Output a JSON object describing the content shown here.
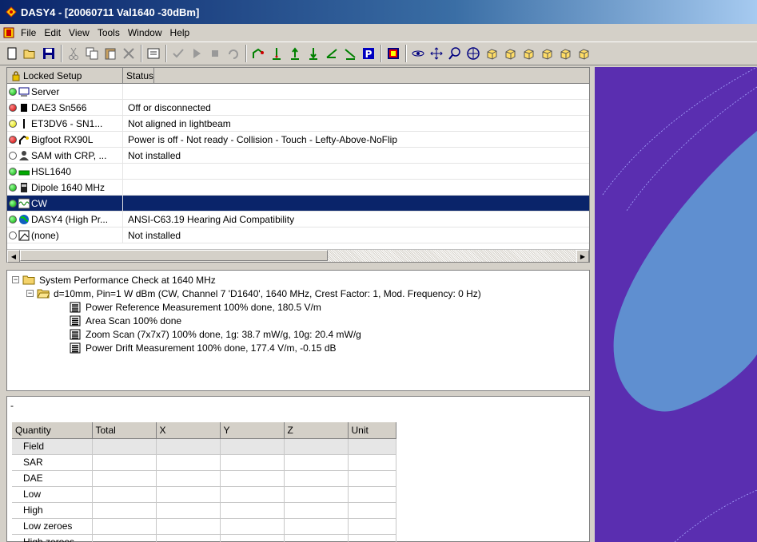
{
  "window": {
    "title": "DASY4 - [20060711 Val1640 -30dBm]"
  },
  "menu": [
    "File",
    "Edit",
    "View",
    "Tools",
    "Window",
    "Help"
  ],
  "toolbar": {
    "icons": [
      "new-icon",
      "open-icon",
      "save-icon",
      "|",
      "cut-icon",
      "copy-icon",
      "paste-icon",
      "delete-icon",
      "|",
      "properties-icon",
      "|",
      "check-icon",
      "play-icon",
      "stop-icon",
      "undo-icon",
      "|",
      "robot-teach-icon",
      "probe-icon",
      "probe-up-icon",
      "probe-down-icon",
      "probe-left-icon",
      "probe-right-icon",
      "parking-icon",
      "|",
      "spectrum-icon",
      "|",
      "rotate-icon",
      "move-icon",
      "zoom-icon",
      "center-icon",
      "cube-1-icon",
      "cube-2-icon",
      "cube-3-icon",
      "cube-4-icon",
      "cube-5-icon",
      "cube-6-icon"
    ]
  },
  "setup": {
    "header": {
      "col1": "Locked Setup",
      "col2": "Status"
    },
    "rows": [
      {
        "dot": "green",
        "icon": "server-icon",
        "name": "Server",
        "status": ""
      },
      {
        "dot": "red",
        "icon": "dae-icon",
        "name": "DAE3 Sn566",
        "status": "Off or disconnected"
      },
      {
        "dot": "yellow",
        "icon": "probe-icon",
        "name": "ET3DV6 - SN1...",
        "status": "Not aligned in lightbeam"
      },
      {
        "dot": "red",
        "icon": "robot-icon",
        "name": "Bigfoot RX90L",
        "status": "Power is off - Not ready - Collision - Touch - Lefty-Above-NoFlip"
      },
      {
        "dot": "white",
        "icon": "phantom-icon",
        "name": "SAM with CRP, ...",
        "status": "Not installed"
      },
      {
        "dot": "green",
        "icon": "hsl-icon",
        "name": "HSL1640",
        "status": ""
      },
      {
        "dot": "green",
        "icon": "dipole-icon",
        "name": "Dipole 1640 MHz",
        "status": ""
      },
      {
        "dot": "green",
        "icon": "signal-icon",
        "name": "CW",
        "status": "",
        "selected": true
      },
      {
        "dot": "green",
        "icon": "globe-icon",
        "name": "DASY4 (High Pr...",
        "status": "ANSI-C63.19 Hearing Aid Compatibility"
      },
      {
        "dot": "white",
        "icon": "none-icon",
        "name": "(none)",
        "status": "Not installed"
      }
    ]
  },
  "tree": {
    "root": "System Performance Check at 1640 MHz",
    "child": "d=10mm, Pin=1 W dBm (CW, Channel 7 'D1640', 1640 MHz, Crest Factor: 1, Mod. Frequency: 0 Hz)",
    "items": [
      "Power Reference Measurement 100% done, 180.5 V/m",
      "Area Scan 100% done",
      "Zoom Scan (7x7x7) 100% done, 1g: 38.7 mW/g, 10g: 20.4 mW/g",
      "Power Drift Measurement 100% done, 177.4 V/m, -0.15 dB"
    ]
  },
  "quantity": {
    "dash": "-",
    "headers": [
      "Quantity",
      "Total",
      "X",
      "Y",
      "Z",
      "Unit"
    ],
    "rows": [
      "Field",
      "SAR",
      "DAE",
      "Low",
      "High",
      "Low zeroes",
      "High zeroes"
    ]
  },
  "colors": {
    "canvas_bg": "#5a2eb0",
    "field_lobe": "#5f8fd0",
    "selection": "#0a246a"
  }
}
